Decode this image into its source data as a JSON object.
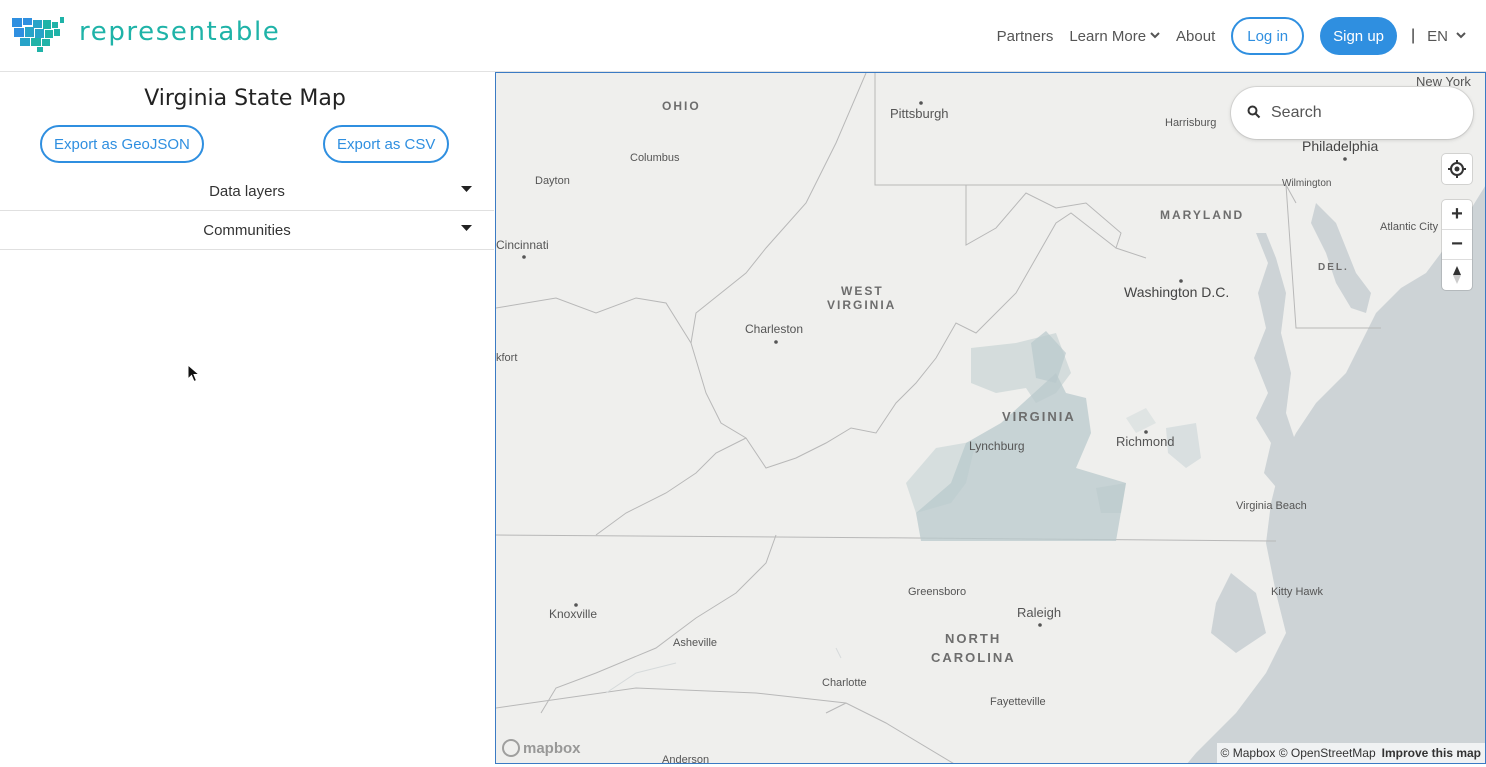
{
  "header": {
    "brand": "representable",
    "nav": {
      "partners": "Partners",
      "learn_more": "Learn More",
      "about": "About",
      "log_in": "Log in",
      "sign_up": "Sign up",
      "separator": "|",
      "language": "EN"
    }
  },
  "sidebar": {
    "title": "Virginia State Map",
    "export_geojson": "Export as GeoJSON",
    "export_csv": "Export as CSV",
    "accordions": [
      {
        "label": "Data layers"
      },
      {
        "label": "Communities"
      }
    ]
  },
  "map": {
    "search_placeholder": "Search",
    "states": {
      "ohio": "OHIO",
      "west_virginia_1": "WEST",
      "west_virginia_2": "VIRGINIA",
      "maryland": "MARYLAND",
      "virginia": "VIRGINIA",
      "delaware": "DEL.",
      "north_carolina_1": "NORTH",
      "north_carolina_2": "CAROLINA"
    },
    "cities": {
      "new_york": "New York",
      "pittsburgh": "Pittsburgh",
      "harrisburg": "Harrisburg",
      "philadelphia": "Philadelphia",
      "columbus": "Columbus",
      "dayton": "Dayton",
      "wilmington": "Wilmington",
      "cincinnati": "Cincinnati",
      "atlantic_city": "Atlantic City",
      "washington": "Washington D.C.",
      "charleston": "Charleston",
      "frankfort": "kfort",
      "lynchburg": "Lynchburg",
      "richmond": "Richmond",
      "virginia_beach": "Virginia Beach",
      "greensboro": "Greensboro",
      "raleigh": "Raleigh",
      "kitty_hawk": "Kitty Hawk",
      "knoxville": "Knoxville",
      "asheville": "Asheville",
      "charlotte": "Charlotte",
      "fayetteville": "Fayetteville",
      "anderson": "Anderson"
    },
    "zoom_in": "+",
    "zoom_out": "−",
    "mapbox_logo": "mapbox",
    "attribution": "© Mapbox © OpenStreetMap",
    "improve": "Improve this map"
  },
  "colors": {
    "brand_teal": "#1fb3a8",
    "accent_blue": "#2f8fe0",
    "map_land": "#efefed",
    "map_water": "#cdd3d6",
    "community_fill": "#b9c9cc"
  }
}
